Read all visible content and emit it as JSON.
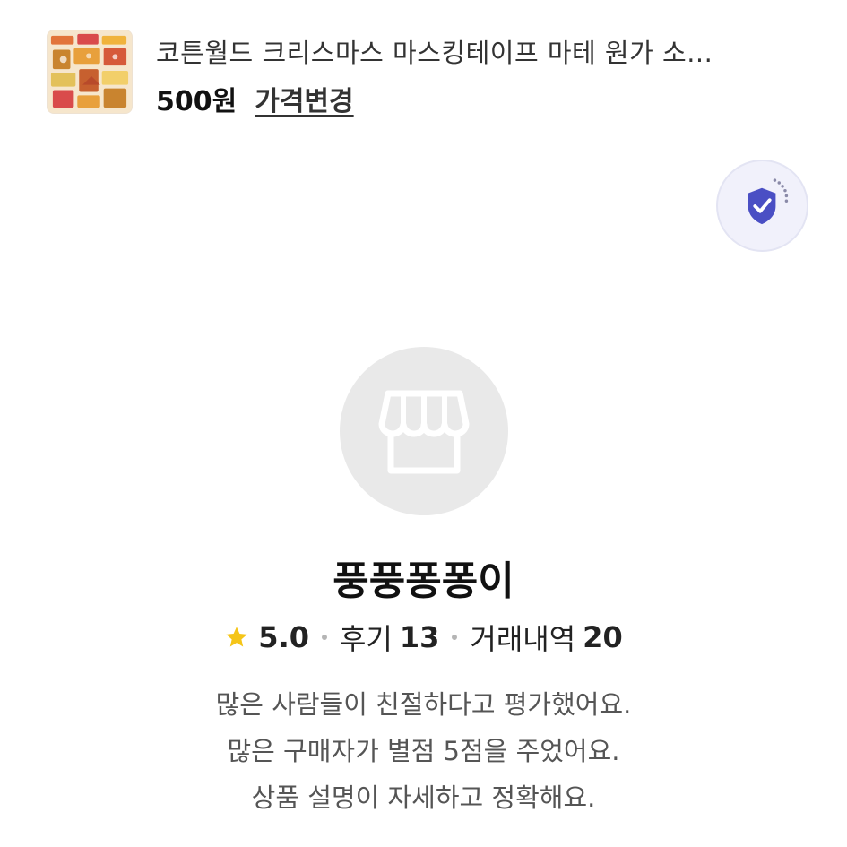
{
  "product": {
    "thumbnail_icon": "product-thumbnail-image",
    "title": "코튼월드 크리스마스 마스킹테이프 마테 원가 소...",
    "price": "500원",
    "price_change_label": "가격변경"
  },
  "shield": {
    "icon": "shield-check-icon",
    "color": "#4a4fc4"
  },
  "store": {
    "avatar_icon": "storefront-icon",
    "name": "풍풍퐁퐁이",
    "rating": "5.0",
    "reviews_label": "후기",
    "reviews_count": "13",
    "trades_label": "거래내역",
    "trades_count": "20",
    "star_color": "#f5c518",
    "descriptions": [
      "많은 사람들이 친절하다고 평가했어요.",
      "많은 구매자가 별점 5점을 주었어요.",
      "상품 설명이 자세하고 정확해요."
    ]
  }
}
